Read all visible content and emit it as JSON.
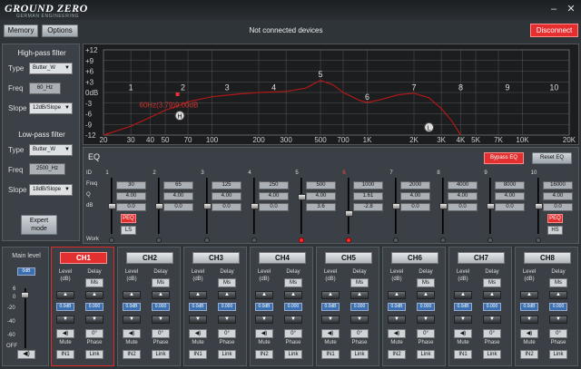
{
  "titlebar": {
    "logo": "GROUND ZERO",
    "logo_sub": "GERMAN ENGINEERING",
    "minimize": "–",
    "close": "✕"
  },
  "menu": {
    "memory": "Memory",
    "options": "Options",
    "status": "Not connected devices",
    "disconnect": "Disconnect"
  },
  "highpass": {
    "title": "High-pass filter",
    "type_label": "Type",
    "type": "Butter_W",
    "freq_label": "Freq",
    "freq": "60_Hz",
    "slope_label": "Slope",
    "slope": "12dB/Slope"
  },
  "lowpass": {
    "title": "Low-pass filter",
    "type_label": "Type",
    "type": "Butter_W",
    "freq_label": "Freq",
    "freq": "2500_Hz",
    "slope_label": "Slope",
    "slope": "18dB/Slope"
  },
  "expert": {
    "label1": "Expert",
    "label2": "mode"
  },
  "graph": {
    "y_ticks": [
      "+12",
      "+9",
      "+6",
      "+3",
      "0dB",
      "-3",
      "-6",
      "-9",
      "-12"
    ],
    "x_ticks": [
      "20",
      "30",
      "40",
      "50",
      "70",
      "100",
      "200",
      "300",
      "500",
      "700",
      "1K",
      "2K",
      "3K",
      "4K",
      "5K",
      "7K",
      "10K",
      "20K"
    ],
    "readout": "60Hz(3.79)9.00dB",
    "h_marker": "H",
    "l_marker": "L",
    "band_labels": [
      "1",
      "2",
      "3",
      "4",
      "5",
      "6",
      "7",
      "8",
      "9",
      "10"
    ],
    "colors": {
      "curve": "#b01818",
      "grid": "#555",
      "marker": "#e33"
    }
  },
  "eq": {
    "title": "EQ",
    "bypass": "Bypass EQ",
    "reset": "Reset EQ",
    "row_labels": {
      "id": "ID",
      "freq": "Freq",
      "q": "Q",
      "db": "dB",
      "work": "Work"
    },
    "peq": "PEQ",
    "ls": "LS",
    "hs": "HS",
    "bands": [
      {
        "id": "1",
        "freq": "30",
        "q": "4.00",
        "db": "0.0",
        "on": false
      },
      {
        "id": "2",
        "freq": "65",
        "q": "4.00",
        "db": "0.0",
        "on": false
      },
      {
        "id": "3",
        "freq": "125",
        "q": "4.00",
        "db": "0.0",
        "on": false
      },
      {
        "id": "4",
        "freq": "250",
        "q": "4.00",
        "db": "0.0",
        "on": false
      },
      {
        "id": "5",
        "freq": "500",
        "q": "4.00",
        "db": "3.6",
        "on": true
      },
      {
        "id": "6",
        "freq": "1000",
        "q": "1.61",
        "db": "-2.8",
        "on": true
      },
      {
        "id": "7",
        "freq": "2000",
        "q": "4.00",
        "db": "0.0",
        "on": false
      },
      {
        "id": "8",
        "freq": "4000",
        "q": "4.00",
        "db": "0.0",
        "on": false
      },
      {
        "id": "9",
        "freq": "8000",
        "q": "4.00",
        "db": "0.0",
        "on": false
      },
      {
        "id": "10",
        "freq": "16000",
        "q": "4.00",
        "db": "0.0",
        "on": false
      }
    ]
  },
  "main_level": {
    "title": "Main level",
    "value": "0dB",
    "scale": [
      "6",
      "0",
      "-20",
      "-40",
      "-60",
      "OFF"
    ],
    "mute_icon": "speaker-icon"
  },
  "channels": {
    "level_label": "Level",
    "db_label": "(dB)",
    "delay_label": "Delay",
    "ms": "Ms",
    "level_val": "0.0dB",
    "delay_val": "0.000",
    "mute_label": "Mute",
    "phase_label": "Phase",
    "phase_val": "0°",
    "link": "Link",
    "list": [
      {
        "name": "CH1",
        "in": "IN1",
        "selected": true
      },
      {
        "name": "CH2",
        "in": "IN2",
        "selected": false
      },
      {
        "name": "CH3",
        "in": "IN1",
        "selected": false
      },
      {
        "name": "CH4",
        "in": "IN2",
        "selected": false
      },
      {
        "name": "CH5",
        "in": "IN1",
        "selected": false
      },
      {
        "name": "CH6",
        "in": "IN2",
        "selected": false
      },
      {
        "name": "CH7",
        "in": "IN1",
        "selected": false
      },
      {
        "name": "CH8",
        "in": "IN2",
        "selected": false
      }
    ]
  }
}
